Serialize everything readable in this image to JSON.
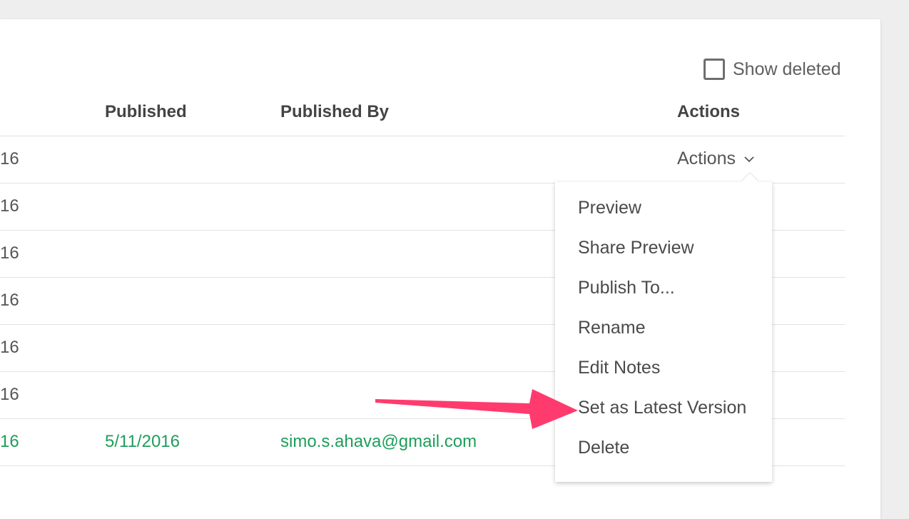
{
  "toolbar": {
    "show_deleted_label": "Show deleted",
    "show_deleted_checked": false
  },
  "table": {
    "columns": [
      "Published",
      "Published By",
      "Actions"
    ],
    "rows": [
      {
        "created_fragment": "16",
        "published": "",
        "published_by": ""
      },
      {
        "created_fragment": "16",
        "published": "",
        "published_by": ""
      },
      {
        "created_fragment": "16",
        "published": "",
        "published_by": ""
      },
      {
        "created_fragment": "16",
        "published": "",
        "published_by": ""
      },
      {
        "created_fragment": "16",
        "published": "",
        "published_by": ""
      },
      {
        "created_fragment": "16",
        "published": "",
        "published_by": ""
      },
      {
        "created_fragment": "16",
        "published": "5/11/2016",
        "published_by": "simo.s.ahava@gmail.com"
      }
    ]
  },
  "actions_dropdown": {
    "label": "Actions",
    "icon": "chevron-down-icon"
  },
  "menu": {
    "items": [
      "Preview",
      "Share Preview",
      "Publish To...",
      "Rename",
      "Edit Notes",
      "Set as Latest Version",
      "Delete"
    ]
  },
  "colors": {
    "published_green": "#1e9e5b",
    "annotation_arrow": "#ff3b6e"
  }
}
